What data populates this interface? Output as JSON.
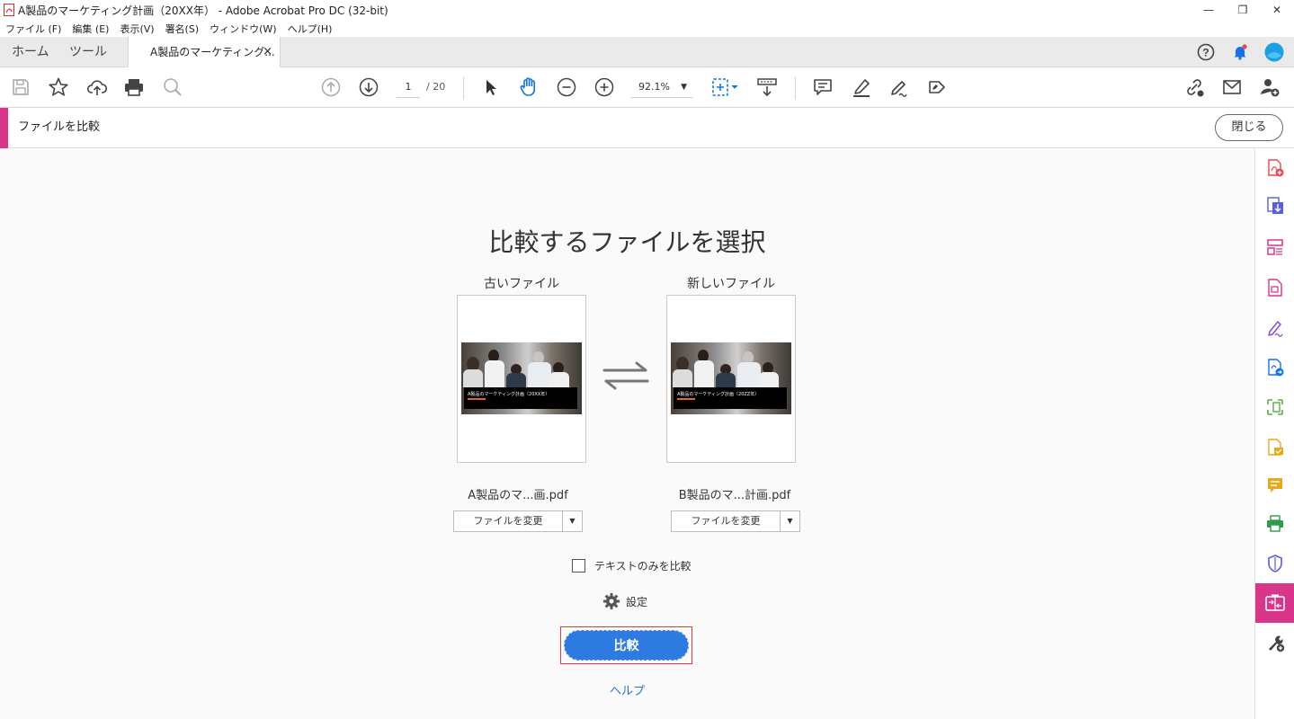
{
  "window": {
    "title": "A製品のマーケティング計画（20XX年） - Adobe Acrobat Pro DC (32-bit)",
    "controls": [
      "—",
      "❐",
      "✕"
    ]
  },
  "menu": [
    "ファイル (F)",
    "編集 (E)",
    "表示(V)",
    "署名(S)",
    "ウィンドウ(W)",
    "ヘルプ(H)"
  ],
  "tabs": {
    "home": "ホーム",
    "tools": "ツール",
    "document": "A製品のマーケティング...",
    "close": "×"
  },
  "toolbar": {
    "page_current": "1",
    "page_total": "/ 20",
    "zoom": "92.1%"
  },
  "compare_header": {
    "title": "ファイルを比較",
    "close_label": "閉じる"
  },
  "main": {
    "heading": "比較するファイルを選択",
    "old_label": "古いファイル",
    "new_label": "新しいファイル",
    "old_thumb_text": "A製品のマーケティング計画（20XX年）",
    "new_thumb_text": "A製品のマーケティング計画（20ZZ年）",
    "old_filename": "A製品のマ...画.pdf",
    "new_filename": "B製品のマ...計画.pdf",
    "change_file": "ファイルを変更",
    "text_only": "テキストのみを比較",
    "settings": "設定",
    "compare": "比較",
    "help": "ヘルプ"
  },
  "colors": {
    "accent": "#d9368b",
    "primary_button": "#2d7ae0",
    "highlight_border": "#e53935",
    "link": "#2d6fd6"
  }
}
